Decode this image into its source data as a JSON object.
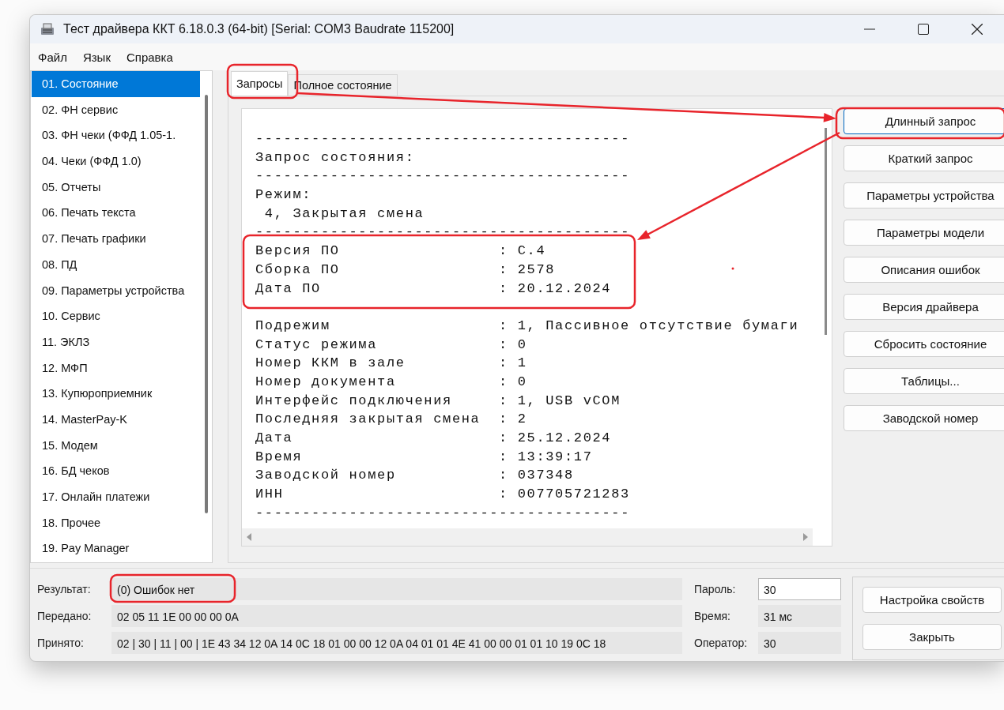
{
  "window": {
    "title": "Тест драйвера ККТ 6.18.0.3 (64-bit) [Serial: COM3 Baudrate 115200]"
  },
  "menu": [
    "Файл",
    "Язык",
    "Справка"
  ],
  "sidebar": {
    "items": [
      {
        "label": "01. Состояние",
        "selected": true
      },
      {
        "label": "02. ФН сервис",
        "selected": false
      },
      {
        "label": "03. ФН чеки (ФФД 1.05-1.",
        "selected": false
      },
      {
        "label": "04. Чеки (ФФД 1.0)",
        "selected": false
      },
      {
        "label": "05. Отчеты",
        "selected": false
      },
      {
        "label": "06. Печать текста",
        "selected": false
      },
      {
        "label": "07. Печать графики",
        "selected": false
      },
      {
        "label": "08. ПД",
        "selected": false
      },
      {
        "label": "09. Параметры устройства",
        "selected": false
      },
      {
        "label": "10. Сервис",
        "selected": false
      },
      {
        "label": "11. ЭКЛЗ",
        "selected": false
      },
      {
        "label": "12. МФП",
        "selected": false
      },
      {
        "label": "13. Купюроприемник",
        "selected": false
      },
      {
        "label": "14. MasterPay-K",
        "selected": false
      },
      {
        "label": "15. Модем",
        "selected": false
      },
      {
        "label": "16. БД чеков",
        "selected": false
      },
      {
        "label": "17. Онлайн платежи",
        "selected": false
      },
      {
        "label": "18. Прочее",
        "selected": false
      },
      {
        "label": "19. Pay Manager",
        "selected": false
      }
    ]
  },
  "tabs": [
    {
      "label": "Запросы",
      "selected": true
    },
    {
      "label": "Полное состояние",
      "selected": false
    }
  ],
  "output": {
    "lines": [
      {
        "kind": "line",
        "text": "----------------------------------------"
      },
      {
        "kind": "line",
        "text": "Запрос состояния:"
      },
      {
        "kind": "line",
        "text": "----------------------------------------"
      },
      {
        "kind": "line",
        "text": "Режим:"
      },
      {
        "kind": "line",
        "text": " 4, Закрытая смена"
      },
      {
        "kind": "line",
        "text": "----------------------------------------"
      },
      {
        "kind": "field",
        "label": "Версия ПО",
        "value": ": C.4"
      },
      {
        "kind": "field",
        "label": "Сборка ПО",
        "value": ": 2578"
      },
      {
        "kind": "field",
        "label": "Дата ПО",
        "value": ": 20.12.2024"
      },
      {
        "kind": "gap"
      },
      {
        "kind": "field",
        "label": "Подрежим",
        "value": ": 1, Пассивное отсутствие бумаги"
      },
      {
        "kind": "field",
        "label": "Статус режима",
        "value": ": 0"
      },
      {
        "kind": "field",
        "label": "Номер ККМ в зале",
        "value": ": 1"
      },
      {
        "kind": "field",
        "label": "Номер документа",
        "value": ": 0"
      },
      {
        "kind": "field",
        "label": "Интерфейс подключения",
        "value": ": 1, USB vCOM"
      },
      {
        "kind": "field",
        "label": "Последняя закрытая смена",
        "value": ": 2"
      },
      {
        "kind": "field",
        "label": "Дата",
        "value": ": 25.12.2024"
      },
      {
        "kind": "field",
        "label": "Время",
        "value": ": 13:39:17"
      },
      {
        "kind": "field",
        "label": "Заводской номер",
        "value": ": 037348"
      },
      {
        "kind": "field",
        "label": "ИНН",
        "value": ": 007705721283"
      },
      {
        "kind": "line",
        "text": "----------------------------------------"
      }
    ]
  },
  "buttons": [
    {
      "label": "Длинный запрос",
      "focused": true
    },
    {
      "label": "Краткий запрос",
      "focused": false
    },
    {
      "label": "Параметры устройства",
      "focused": false
    },
    {
      "label": "Параметры модели",
      "focused": false
    },
    {
      "label": "Описания ошибок",
      "focused": false
    },
    {
      "label": "Версия драйвера",
      "focused": false
    },
    {
      "label": "Сбросить состояние",
      "focused": false
    },
    {
      "label": "Таблицы...",
      "focused": false
    },
    {
      "label": "Заводской номер",
      "focused": false
    }
  ],
  "status": {
    "left": [
      {
        "label": "Результат:",
        "value": "(0) Ошибок нет",
        "editable": false
      },
      {
        "label": "Передано:",
        "value": "02 05 11 1E 00 00 00 0A",
        "editable": false
      },
      {
        "label": "Принято:",
        "value": "02 | 30 | 11 | 00 | 1E 43 34 12 0A 14 0C 18 01 00 00 12 0A 04 01 01 4E 41 00 00 01 01 10 19 0C 18",
        "editable": false
      }
    ],
    "right": [
      {
        "label": "Пароль:",
        "value": "30",
        "editable": true
      },
      {
        "label": "Время:",
        "value": "31 мс",
        "editable": false
      },
      {
        "label": "Оператор:",
        "value": "30",
        "editable": false
      }
    ],
    "buttons": [
      "Настройка свойств",
      "Закрыть"
    ]
  }
}
